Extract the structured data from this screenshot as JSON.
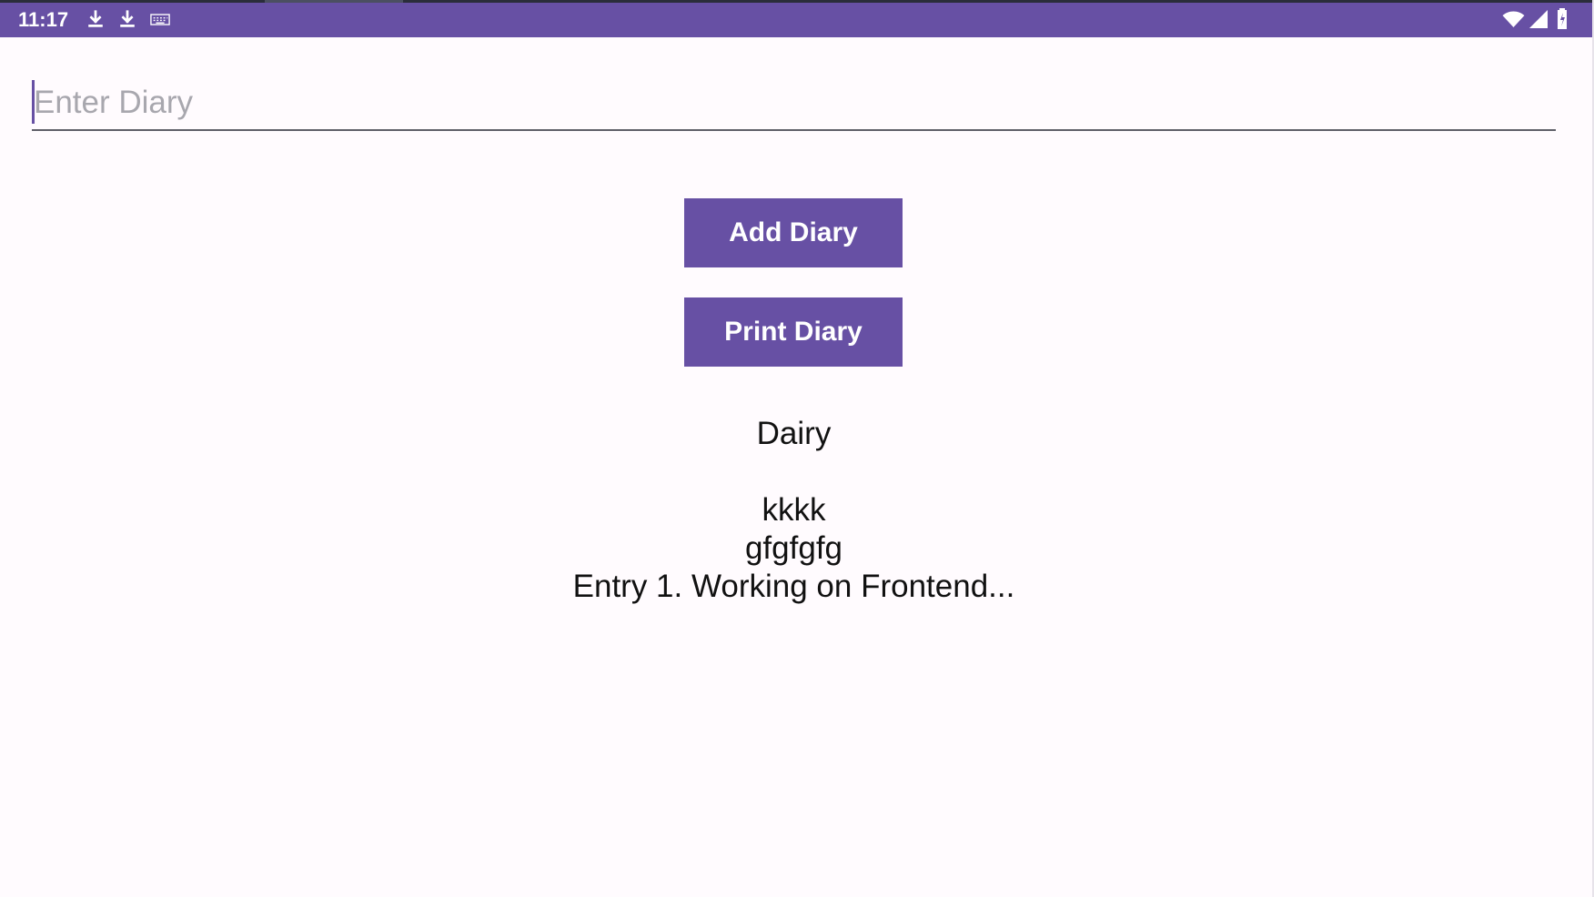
{
  "status_bar": {
    "time": "11:17",
    "background": "#6750a4",
    "icons": [
      "download-icon",
      "download-icon",
      "keyboard-icon",
      "wifi-icon",
      "signal-icon",
      "battery-icon"
    ]
  },
  "diary_input": {
    "value": "",
    "placeholder": "Enter Diary"
  },
  "actions": {
    "add_label": "Add Diary",
    "print_label": "Print Diary"
  },
  "diary": {
    "title": "Dairy",
    "entries": [
      "kkkk",
      "gfgfgfg",
      "Entry 1. Working on Frontend..."
    ]
  },
  "colors": {
    "accent": "#6750a4",
    "background": "#fffbfe",
    "text": "#111111",
    "placeholder": "#a8a7ae"
  }
}
